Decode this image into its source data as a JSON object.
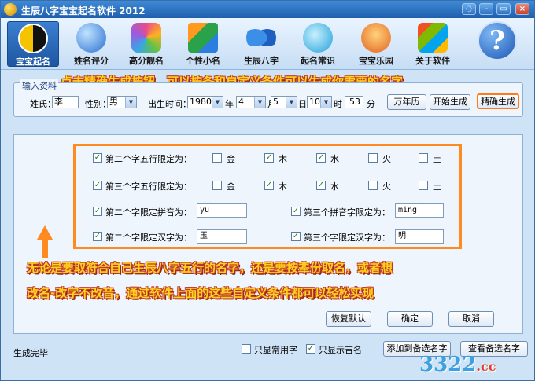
{
  "window": {
    "title": "生辰八字宝宝起名软件  2012"
  },
  "toolbar": {
    "items": [
      {
        "label": "宝宝起名",
        "icon": "yinyang-icon"
      },
      {
        "label": "姓名评分",
        "icon": "globe-icon"
      },
      {
        "label": "高分靓名",
        "icon": "hexagons-icon"
      },
      {
        "label": "个性小名",
        "icon": "cubes-icon"
      },
      {
        "label": "生辰八字",
        "icon": "butterfly-icon"
      },
      {
        "label": "起名常识",
        "icon": "bubble-icon"
      },
      {
        "label": "宝宝乐园",
        "icon": "mascot-icon"
      },
      {
        "label": "关于软件",
        "icon": "windows-flag-icon"
      }
    ],
    "help": "?"
  },
  "input": {
    "legend": "输入资料",
    "surname_label": "姓氏：",
    "surname_value": "李",
    "gender_label": "性别：",
    "gender_value": "男",
    "birth_label": "出生时间：",
    "year_value": "1980",
    "year_unit": "年",
    "month_value": "4",
    "month_unit": "月",
    "day_value": "5",
    "day_unit": "日",
    "hour_value": "10",
    "hour_unit": "时",
    "minute_value": "53",
    "minute_unit": "分",
    "calendar_button": "万年历",
    "start_button": "开始生成",
    "precise_button": "精确生成"
  },
  "options": {
    "second_wuxing_label": "第二个字五行限定为：",
    "third_wuxing_label": "第三个字五行限定为：",
    "elements": [
      "金",
      "木",
      "水",
      "火",
      "土"
    ],
    "second_checked": [
      false,
      true,
      true,
      false,
      false
    ],
    "third_checked": [
      false,
      true,
      true,
      false,
      false
    ],
    "second_pinyin_label": "第二个字限定拼音为：",
    "second_pinyin_value": "yu",
    "third_pinyin_label": "第三个拼音字限定为：",
    "third_pinyin_value": "ming",
    "second_hanzi_label": "第二个字限定汉字为：",
    "second_hanzi_value": "玉",
    "third_hanzi_label": "第三个字限定汉字为：",
    "third_hanzi_value": "明",
    "restore_button": "恢复默认",
    "ok_button": "确定",
    "cancel_button": "取消"
  },
  "annotations": {
    "top": "点击精确生成按钮，可以按条和自定义条件可以生成你需要的名字",
    "middle_line1": "无论是要取符合自己生辰八字五行的名字，还是要按辈份取名，或者想",
    "middle_line2": "改名-改字不改音，通过软件上面的这些自定义条件都可以轻松实现"
  },
  "footer": {
    "status": "生成完毕",
    "common_only_label": "只显常用字",
    "lucky_only_label": "只显示吉名",
    "add_button": "添加到备选名字",
    "view_button": "查看备选名字"
  },
  "watermark": {
    "main": "3322",
    "suffix": ".cc"
  }
}
